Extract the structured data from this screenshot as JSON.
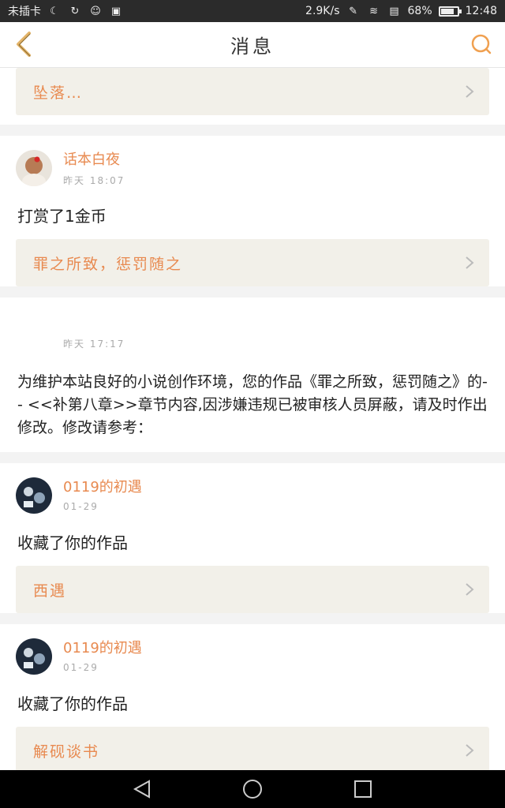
{
  "status_bar": {
    "carrier": "未插卡",
    "speed": "2.9K/s",
    "battery": "68%",
    "battery_level": 0.68,
    "time": "12:48"
  },
  "header": {
    "title": "消息",
    "back_icon": "chevron-left-icon",
    "search_icon": "search-icon"
  },
  "colors": {
    "accent": "#e88a50",
    "link_bg": "#f2f0e9"
  },
  "items": [
    {
      "link": "坠落…"
    },
    {
      "username": "话本白夜",
      "time": "昨天 18:07",
      "action": "打赏了1金币",
      "link": "罪之所致，惩罚随之"
    },
    {
      "time": "昨天 17:17",
      "text": "为维护本站良好的小说创作环境，您的作品《罪之所致，惩罚随之》的-- <<补第八章>>章节内容,因涉嫌违规已被审核人员屏蔽，请及时作出修改。修改请参考："
    },
    {
      "username": "0119的初遇",
      "time": "01-29",
      "action": "收藏了你的作品",
      "link": "西遇"
    },
    {
      "username": "0119的初遇",
      "time": "01-29",
      "action": "收藏了你的作品",
      "link": "解砚谈书"
    }
  ]
}
